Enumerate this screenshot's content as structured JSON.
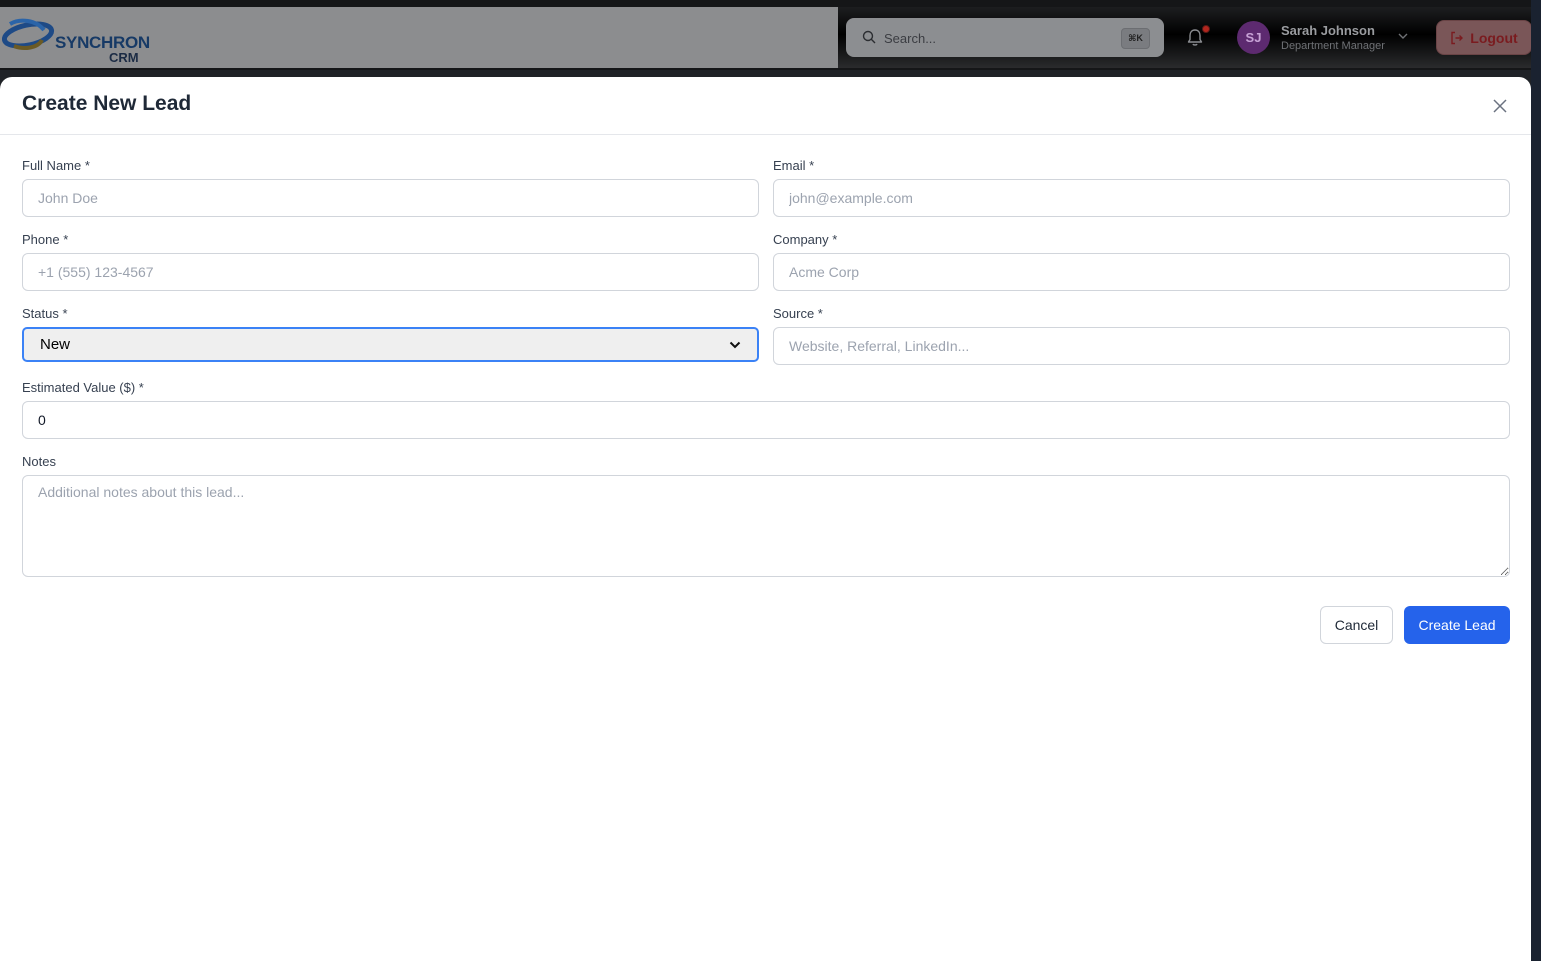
{
  "app": {
    "logo_text": "SYNCHRON",
    "logo_sub": "CRM"
  },
  "header": {
    "search_placeholder": "Search...",
    "search_shortcut": "⌘K",
    "user": {
      "initials": "SJ",
      "name": "Sarah Johnson",
      "role": "Department Manager"
    },
    "logout_label": "Logout"
  },
  "modal": {
    "title": "Create New Lead",
    "fields": {
      "full_name": {
        "label": "Full Name *",
        "placeholder": "John Doe",
        "value": ""
      },
      "email": {
        "label": "Email *",
        "placeholder": "john@example.com",
        "value": ""
      },
      "phone": {
        "label": "Phone *",
        "placeholder": "+1 (555) 123-4567",
        "value": ""
      },
      "company": {
        "label": "Company *",
        "placeholder": "Acme Corp",
        "value": ""
      },
      "status": {
        "label": "Status *",
        "value": "New"
      },
      "source": {
        "label": "Source *",
        "placeholder": "Website, Referral, LinkedIn...",
        "value": ""
      },
      "estimated_value": {
        "label": "Estimated Value ($) *",
        "value": "0"
      },
      "notes": {
        "label": "Notes",
        "placeholder": "Additional notes about this lead...",
        "value": ""
      }
    },
    "cancel_label": "Cancel",
    "submit_label": "Create Lead"
  },
  "colors": {
    "primary": "#2563eb",
    "focus_ring": "#3b82f6",
    "logout_text": "#7a1b1f",
    "avatar_bg": "#5d2a70"
  }
}
